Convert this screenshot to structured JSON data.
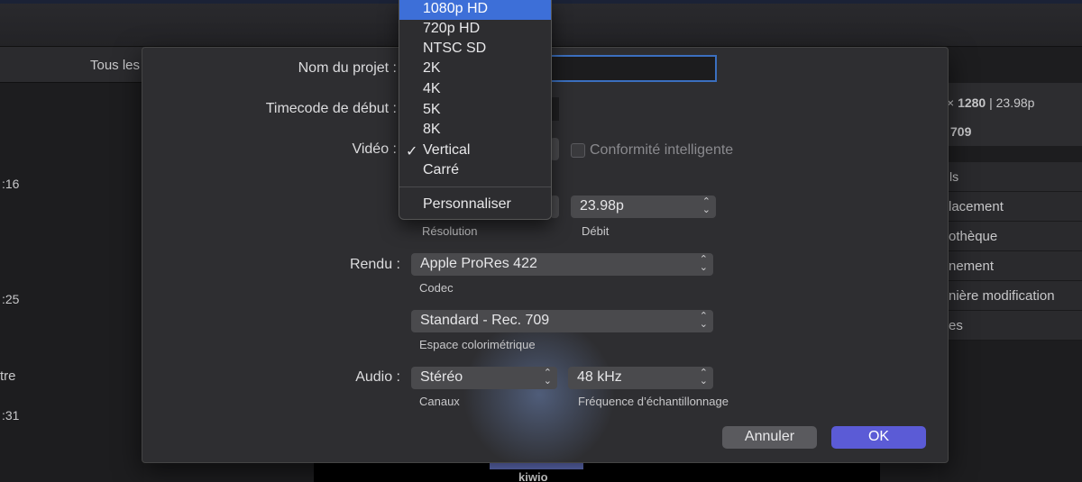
{
  "background": {
    "left_header": "Tous les",
    "left_times": [
      ":16",
      ":25",
      "tre",
      ":31"
    ],
    "right_top": {
      "resolution_prefix": "× ",
      "resolution_bold": "1280",
      "framerate": " | 23.98p",
      "second": "709"
    },
    "right_rows": [
      "ls",
      "lacement",
      "othèque",
      "nement",
      "nière modification",
      "es"
    ],
    "video_text": "kiwio"
  },
  "dialog": {
    "project_name_label": "Nom du projet :",
    "project_name_value": "",
    "timecode_label": "Timecode de début :",
    "video_label": "Vidéo :",
    "smart_conform_label": "Conformité intelligente",
    "smart_conform_checked": false,
    "resolution_sublabel": "Résolution",
    "framerate_value": "23.98p",
    "framerate_sublabel": "Débit",
    "render_label": "Rendu :",
    "codec_value": "Apple ProRes 422",
    "codec_sublabel": "Codec",
    "colorspace_value": "Standard - Rec. 709",
    "colorspace_sublabel": "Espace colorimétrique",
    "audio_label": "Audio :",
    "channels_value": "Stéréo",
    "channels_sublabel": "Canaux",
    "samplerate_value": "48 kHz",
    "samplerate_sublabel": "Fréquence d’échantillonnage",
    "cancel_label": "Annuler",
    "ok_label": "OK"
  },
  "video_menu": {
    "items": [
      {
        "label": "1080p HD",
        "highlighted": true,
        "checked": false
      },
      {
        "label": "720p HD",
        "highlighted": false,
        "checked": false
      },
      {
        "label": "NTSC SD",
        "highlighted": false,
        "checked": false
      },
      {
        "label": "2K",
        "highlighted": false,
        "checked": false
      },
      {
        "label": "4K",
        "highlighted": false,
        "checked": false
      },
      {
        "label": "5K",
        "highlighted": false,
        "checked": false
      },
      {
        "label": "8K",
        "highlighted": false,
        "checked": false
      },
      {
        "label": "Vertical",
        "highlighted": false,
        "checked": true
      },
      {
        "label": "Carré",
        "highlighted": false,
        "checked": false
      }
    ],
    "custom_label": "Personnaliser",
    "check_glyph": "✓"
  },
  "colors": {
    "accent": "#5b5bd6",
    "highlight": "#3d6fd8",
    "focus_ring": "#3b6fbf"
  }
}
